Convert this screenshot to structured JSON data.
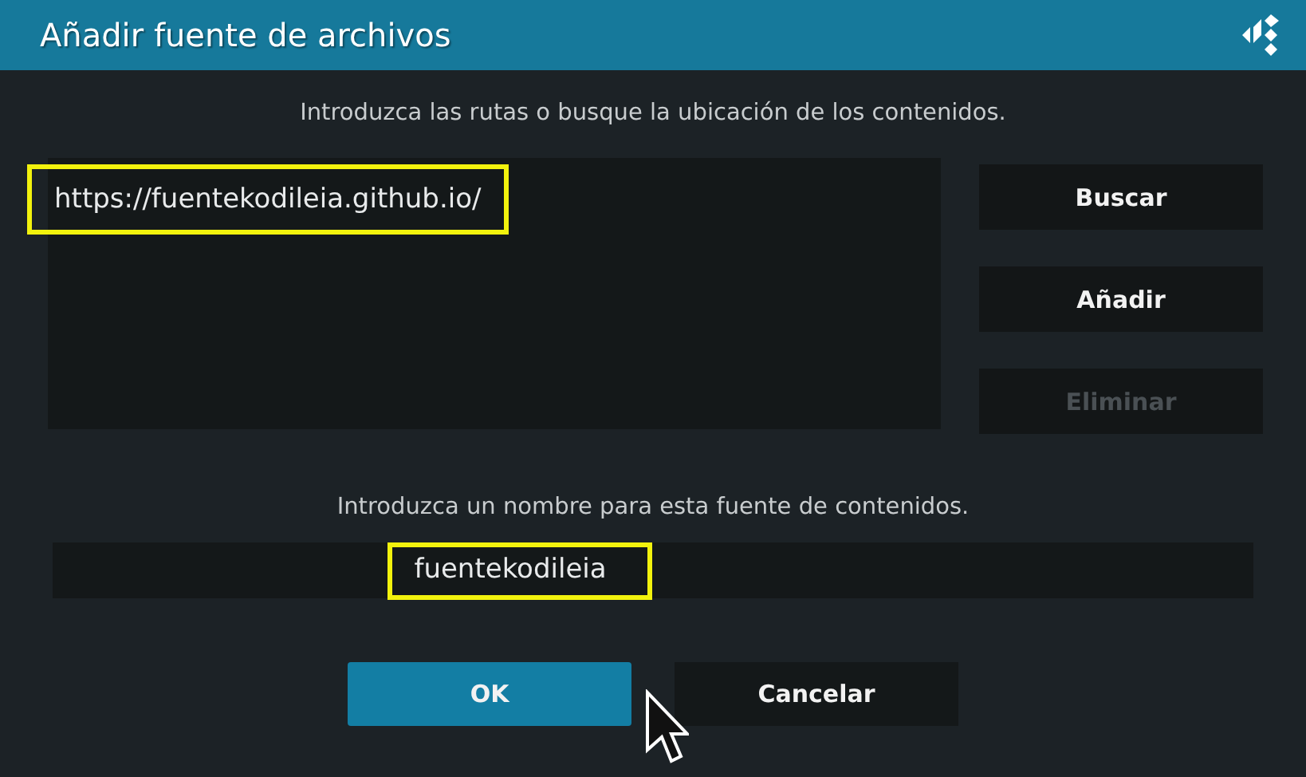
{
  "window": {
    "title": "Añadir fuente de archivos"
  },
  "paths_prompt": "Introduzca las rutas o busque la ubicación de los contenidos.",
  "paths": [
    {
      "text": "https://fuentekodileia.github.io/",
      "highlighted": true
    }
  ],
  "side_buttons": [
    {
      "label": "Buscar",
      "disabled": false
    },
    {
      "label": "Añadir",
      "disabled": false
    },
    {
      "label": "Eliminar",
      "disabled": true
    }
  ],
  "name_prompt": "Introduzca un nombre para esta fuente de contenidos.",
  "name_field": {
    "value": "fuentekodileia",
    "highlighted": true
  },
  "buttons": [
    {
      "label": "OK",
      "selected": true
    },
    {
      "label": "Cancelar",
      "selected": false
    }
  ]
}
